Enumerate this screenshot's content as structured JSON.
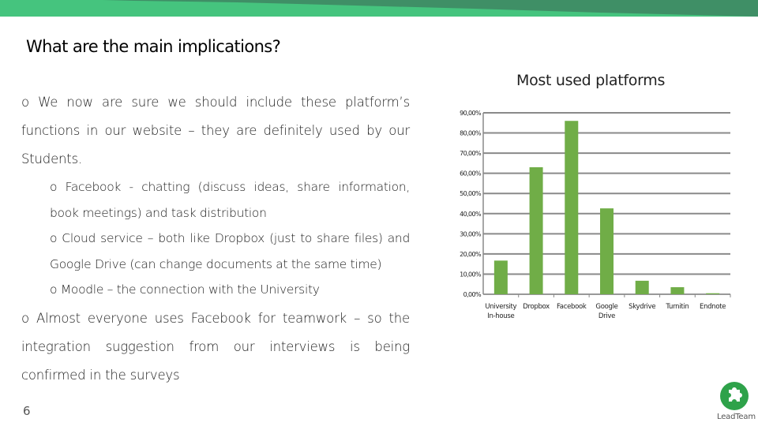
{
  "slide": {
    "title": "What are the main implications?",
    "page_number": "6",
    "accent_colors": {
      "banner_light": "#45C47E",
      "banner_dark": "#3F8F66",
      "bar": "#70AD47",
      "logo": "#2EA24A"
    },
    "bullets": [
      {
        "marker": "o",
        "text": "We now are sure we should include these platform’s functions in our website – they are definitely used by our Students."
      },
      {
        "marker": "o",
        "text": "Facebook - chatting (discuss ideas, share information, book meetings) and  task distribution",
        "level": 2
      },
      {
        "marker": "o",
        "text": "Cloud service – both like Dropbox (just to share files) and Google Drive (can change documents at the same time)",
        "level": 2
      },
      {
        "marker": "o",
        "text": "Moodle – the connection with the University",
        "level": 2
      },
      {
        "marker": "o",
        "text": "Almost everyone uses Facebook for teamwork – so the integration suggestion from our interviews is being confirmed in the surveys"
      }
    ],
    "logo": {
      "icon": "puzzle-icon",
      "text": "LeadTeam"
    }
  },
  "chart_data": {
    "type": "bar",
    "title": "Most used platforms",
    "categories": [
      "University In-house",
      "Dropbox",
      "Facebook",
      "Google Drive",
      "Skydrive",
      "Turnitin",
      "Endnote"
    ],
    "category_lines": [
      [
        "University",
        "In-house"
      ],
      [
        "Dropbox"
      ],
      [
        "Facebook"
      ],
      [
        "Google",
        "Drive"
      ],
      [
        "Skydrive"
      ],
      [
        "Turnitin"
      ],
      [
        "Endnote"
      ]
    ],
    "values": [
      16.7,
      63.0,
      86.0,
      42.6,
      6.7,
      3.5,
      0.5
    ],
    "unit": "%",
    "ylim": [
      0,
      90
    ],
    "yticks": [
      0,
      10,
      20,
      30,
      40,
      50,
      60,
      70,
      80,
      90
    ],
    "ytick_labels": [
      "0,00%",
      "10,00%",
      "20,00%",
      "30,00%",
      "40,00%",
      "50,00%",
      "60,00%",
      "70,00%",
      "80,00%",
      "90,00%"
    ],
    "xlabel": "",
    "ylabel": "",
    "grid": true,
    "legend": "none"
  }
}
